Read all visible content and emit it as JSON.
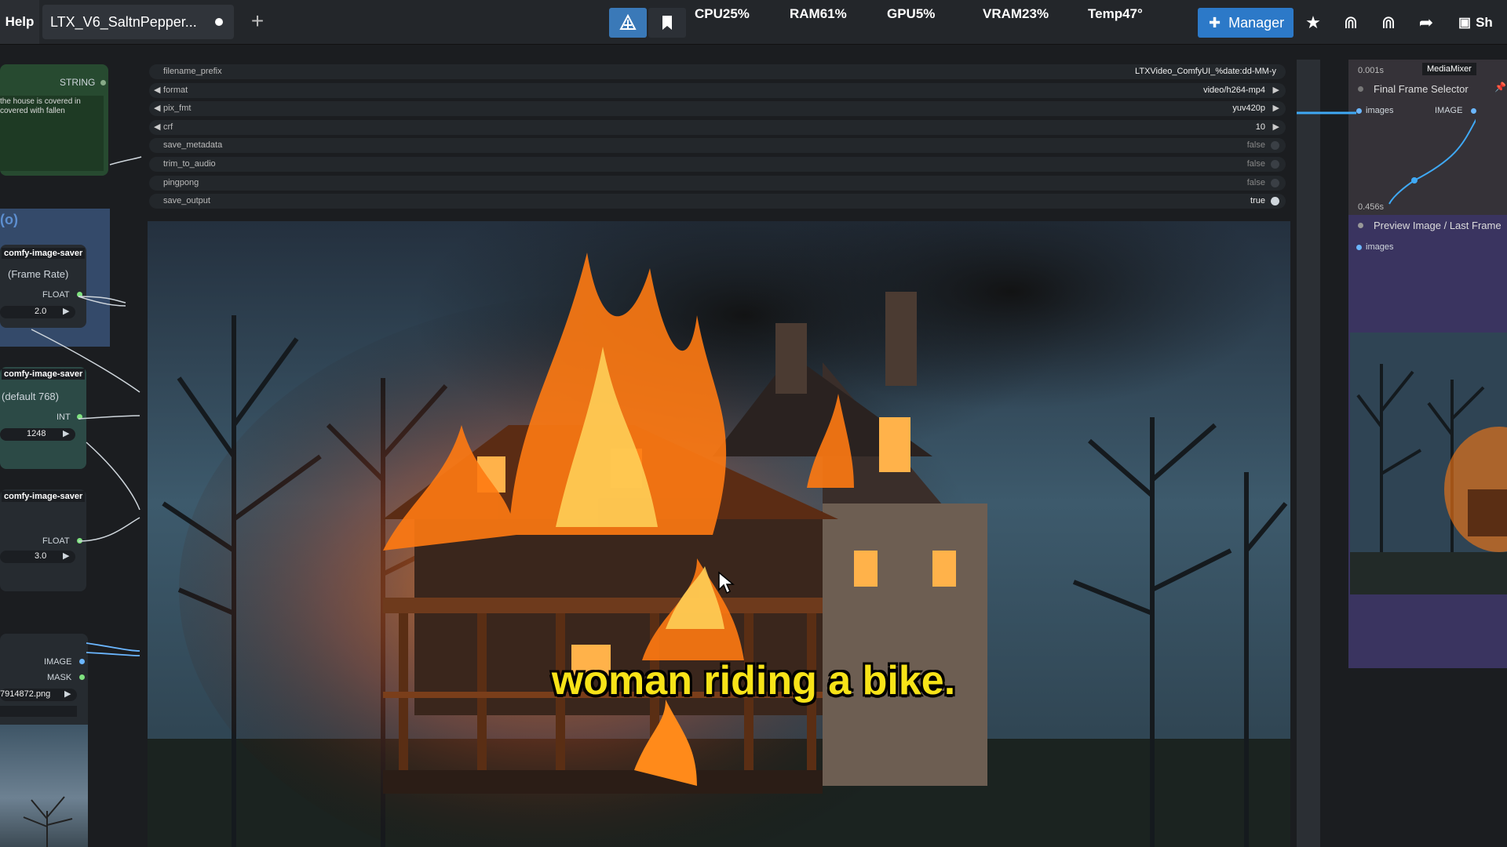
{
  "topbar": {
    "help_label": "Help",
    "tab_title": "LTX_V6_SaltnPepper...",
    "new_tab_label": "+",
    "stats": {
      "cpu": "CPU25%",
      "ram": "RAM61%",
      "gpu": "GPU5%",
      "vram": "VRAM23%",
      "temp": "Temp47°"
    },
    "manager_label": "Manager",
    "share_label": "Sh"
  },
  "left_nodes": {
    "string_node": {
      "type_label": "STRING",
      "text": "the house is covered in covered with fallen"
    },
    "group_title": "(o)",
    "node1": {
      "badge": "comfy-image-saver",
      "title": "(Frame Rate)",
      "output": "FLOAT",
      "value": "2.0"
    },
    "node2": {
      "badge": "comfy-image-saver",
      "title": "(default 768)",
      "output": "INT",
      "value": "1248"
    },
    "node3": {
      "badge": "comfy-image-saver",
      "output": "FLOAT",
      "value": "3.0"
    },
    "node4": {
      "output_image": "IMAGE",
      "output_mask": "MASK",
      "file": "7914872.png"
    }
  },
  "widgets": [
    {
      "key": "filename_prefix",
      "value": "LTXVideo_ComfyUI_%date:dd-MM-y",
      "kind": "text"
    },
    {
      "key": "format",
      "value": "video/h264-mp4",
      "kind": "combo"
    },
    {
      "key": "pix_fmt",
      "value": "yuv420p",
      "kind": "combo"
    },
    {
      "key": "crf",
      "value": "10",
      "kind": "combo"
    },
    {
      "key": "save_metadata",
      "value": "false",
      "kind": "toggle"
    },
    {
      "key": "trim_to_audio",
      "value": "false",
      "kind": "toggle"
    },
    {
      "key": "pingpong",
      "value": "false",
      "kind": "toggle"
    },
    {
      "key": "save_output",
      "value": "true",
      "kind": "toggle"
    }
  ],
  "subtitle": "woman riding a bike.",
  "right_panel": {
    "timer_top": "0.001s",
    "badge": "MediaMixer",
    "node1_title": "Final Frame Selector",
    "node1_input": "images",
    "node1_output": "IMAGE",
    "timer_mid": "0.456s",
    "node2_title": "Preview Image / Last Frame",
    "node2_input": "images"
  },
  "colors": {
    "accent": "#2c79c8",
    "subtitle": "#f7e318",
    "link": "#3fa9f5"
  }
}
